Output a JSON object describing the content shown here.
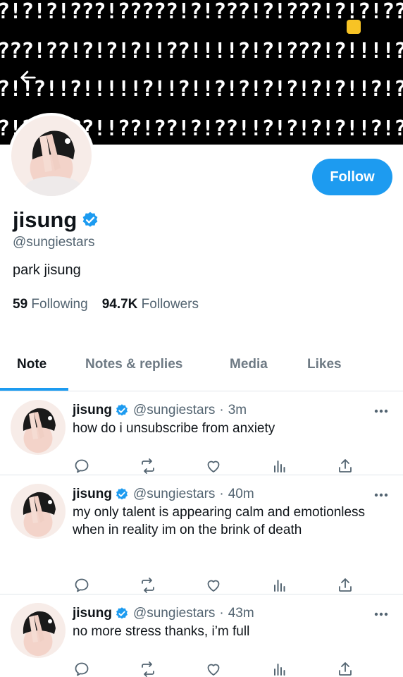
{
  "banner": {
    "rows": [
      "?!?!?!???!?????!?!???!?!???!?!?!???",
      "???!??!?!?!?!!??!!!!?!?!???!?!!!!?!??",
      "?!!?!!?!!!!!?!!?!!?!?!?!?!?!?!!?!?!!!?!!?!",
      "?!??!???!!??!??!?!??!!?!?!?!?!!?!?!?!"
    ]
  },
  "profile": {
    "name": "jisung",
    "handle": "@sungiestars",
    "bio": "park jisung",
    "following_count": "59",
    "following_label": "Following",
    "followers_count": "94.7K",
    "followers_label": "Followers",
    "follow_button": "Follow"
  },
  "tabs": [
    "Note",
    "Notes & replies",
    "Media",
    "Likes"
  ],
  "tweets": [
    {
      "name": "jisung",
      "handle": "@sungiestars",
      "time": "3m",
      "text": "how do i unsubscribe from anxiety"
    },
    {
      "name": "jisung",
      "handle": "@sungiestars",
      "time": "40m",
      "text": "my only talent is appearing calm and emotionless when in reality im on the brink of death"
    },
    {
      "name": "jisung",
      "handle": "@sungiestars",
      "time": "43m",
      "text": "no more stress thanks, i’m full"
    }
  ],
  "colors": {
    "accent": "#1d9bf0",
    "secondary_text": "#536471",
    "banner_bg": "#000000"
  }
}
